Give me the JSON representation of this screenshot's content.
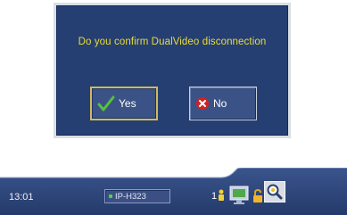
{
  "dialog": {
    "message": "Do you confirm DualVideo disconnection",
    "yes_label": "Yes",
    "no_label": "No"
  },
  "taskbar": {
    "time": "13:01",
    "connection_label": "IP-H323",
    "icons": {
      "endpoint": "1-person-icon",
      "monitor": "monitor-icon",
      "lock": "lock-icon",
      "zoom": "magnifier-icon"
    }
  },
  "colors": {
    "dialog_bg": "#263f72",
    "message_text": "#e8dd36",
    "taskbar_bg": "#2c4479",
    "yes_check": "#56c23a",
    "no_x": "#d42020",
    "status_dot": "#4cd64c"
  }
}
